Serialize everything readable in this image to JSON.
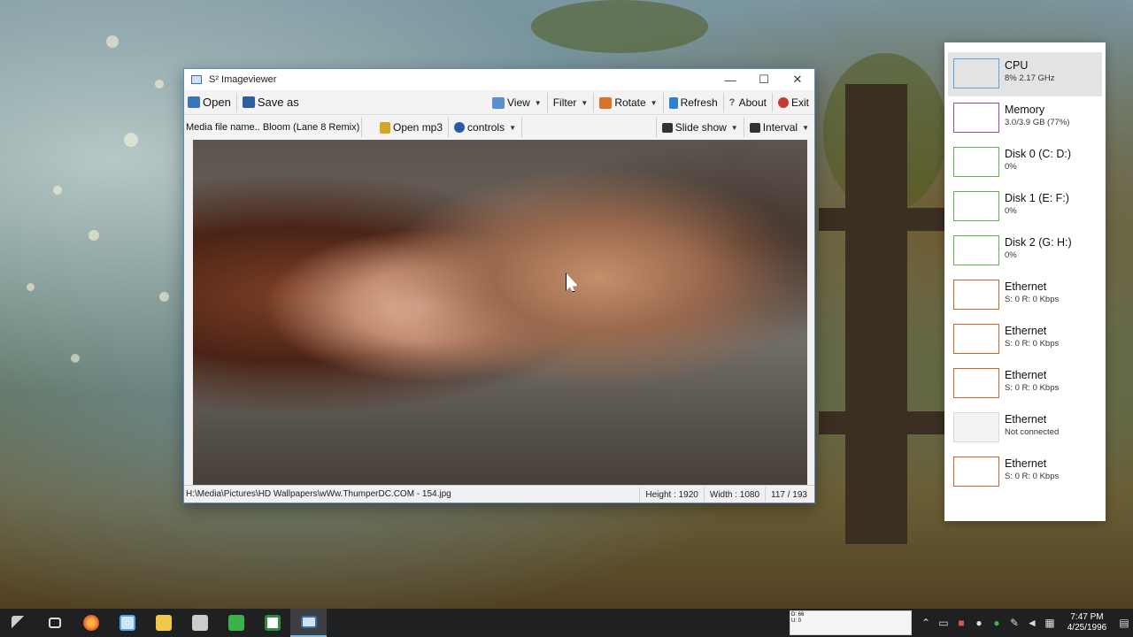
{
  "window": {
    "title": "S² Imageviewer",
    "controls": {
      "minimize": "—",
      "maximize": "☐",
      "close": "✕"
    }
  },
  "toolbar": {
    "open": "Open",
    "save_as": "Save as",
    "view": "View",
    "filter": "Filter",
    "rotate": "Rotate",
    "refresh": "Refresh",
    "about": "About",
    "exit": "Exit"
  },
  "toolbar2": {
    "media_file_name_value": "Media file name.. Bloom (Lane 8 Remix)",
    "open_mp3": "Open mp3",
    "controls": "controls",
    "slide_show": "Slide show",
    "interval": "Interval"
  },
  "status": {
    "path": "H:\\Media\\Pictures\\HD Wallpapers\\wWw.ThumperDC.COM  -  154.jpg",
    "height": "Height :  1920",
    "width": "Width :  1080",
    "position": "117  /  193"
  },
  "perf_panel": {
    "items": [
      {
        "title": "CPU",
        "sub": "8%  2.17 GHz",
        "color": "#5ba0d8"
      },
      {
        "title": "Memory",
        "sub": "3.0/3.9 GB (77%)",
        "color": "#9b4aa8"
      },
      {
        "title": "Disk 0 (C: D:)",
        "sub": "0%",
        "color": "#5bb548"
      },
      {
        "title": "Disk 1 (E: F:)",
        "sub": "0%",
        "color": "#5bb548"
      },
      {
        "title": "Disk 2 (G: H:)",
        "sub": "0%",
        "color": "#5bb548"
      },
      {
        "title": "Ethernet",
        "sub": "S: 0  R: 0 Kbps",
        "color": "#c86428"
      },
      {
        "title": "Ethernet",
        "sub": "S: 0  R: 0 Kbps",
        "color": "#c86428"
      },
      {
        "title": "Ethernet",
        "sub": "S: 0  R: 0 Kbps",
        "color": "#c86428"
      },
      {
        "title": "Ethernet",
        "sub": "Not connected",
        "color": "#d8d8d8"
      },
      {
        "title": "Ethernet",
        "sub": "S: 0  R: 0 Kbps",
        "color": "#c86428"
      }
    ]
  },
  "taskbar": {
    "mini_graph_labels": [
      "D: 66",
      "U: 0"
    ],
    "time": "7:47 PM",
    "date": "4/25/1996"
  }
}
